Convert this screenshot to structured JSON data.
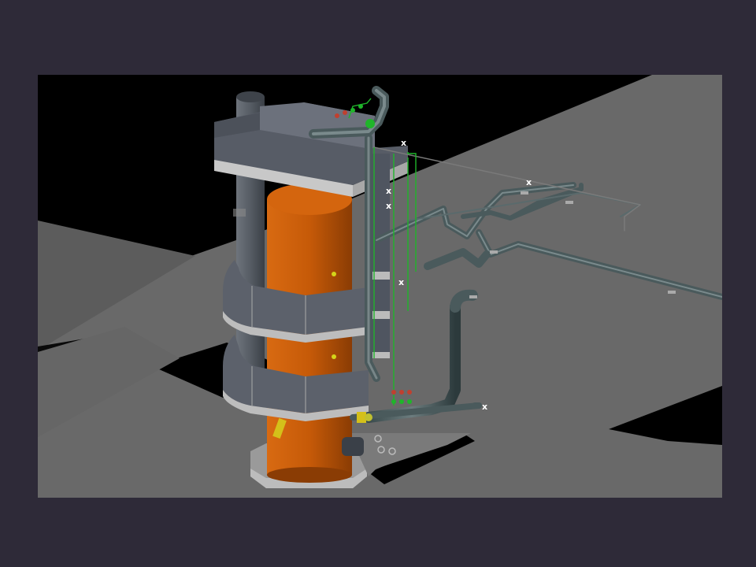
{
  "viewport": {
    "background": "#000000",
    "ground_color": "#6b6b6b",
    "vessel_color": "#c65a08",
    "steel_color": "#5a6068",
    "pipe_color": "#4a5a5c",
    "line_green": "#1fb52a"
  },
  "markers": [
    "x",
    "x",
    "x",
    "x",
    "x",
    "x"
  ],
  "icons": [
    "vessel-3d-model",
    "pipe-network",
    "spiral-platform",
    "instrument-valve"
  ]
}
